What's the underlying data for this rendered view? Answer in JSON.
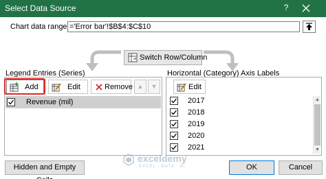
{
  "dialog": {
    "title": "Select Data Source",
    "help_label": "?",
    "close_label": "×"
  },
  "chart_data_range": {
    "label": "Chart data range:",
    "value": "='Error bar'!$B$4:$C$10"
  },
  "switch_button": {
    "label": "Switch Row/Column"
  },
  "legend_entries": {
    "label": "Legend Entries (Series)",
    "add_label": "Add",
    "edit_label": "Edit",
    "remove_label": "Remove",
    "series": [
      {
        "name": "Revenue (mil)",
        "checked": true
      }
    ]
  },
  "axis_labels": {
    "label": "Horizontal (Category) Axis Labels",
    "edit_label": "Edit",
    "items": [
      {
        "label": "2017",
        "checked": true
      },
      {
        "label": "2018",
        "checked": true
      },
      {
        "label": "2019",
        "checked": true
      },
      {
        "label": "2020",
        "checked": true
      },
      {
        "label": "2021",
        "checked": true
      }
    ]
  },
  "footer": {
    "hidden_cells_label": "Hidden and Empty Cells",
    "ok_label": "OK",
    "cancel_label": "Cancel"
  },
  "watermark": {
    "name": "exceldemy",
    "tagline": "EXCEL · DATA · BI"
  },
  "colors": {
    "titlebar": "#217346",
    "highlight": "#e02525",
    "selected_row": "#cfcfcf"
  }
}
